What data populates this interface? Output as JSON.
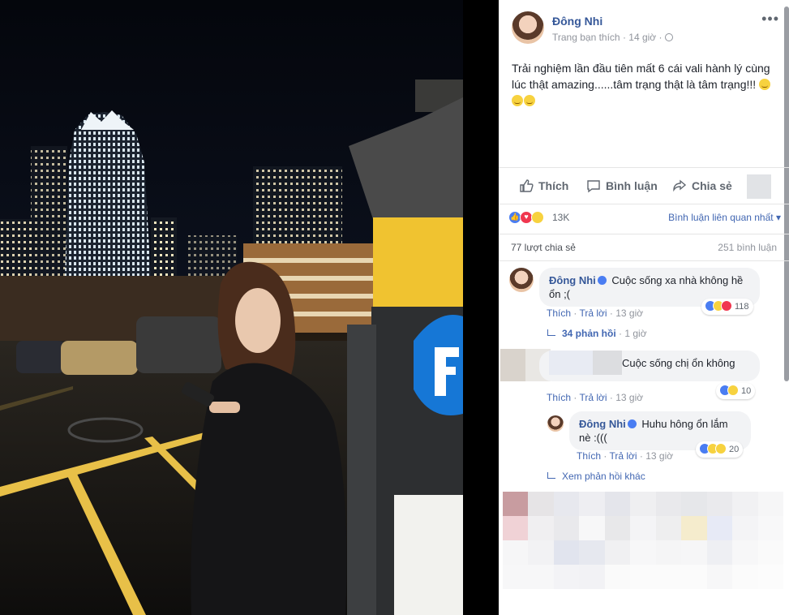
{
  "post": {
    "author": "Đông Nhi",
    "subtitle": "Trang bạn thích · 14 giờ ·",
    "more": "•••",
    "text": "Trải nghiệm lần đầu tiên mất 6 cái vali hành lý cùng lúc thật amazing......tâm trạng thật là tâm trạng!!!",
    "emoji_count": 3
  },
  "actions": {
    "like": "Thích",
    "comment": "Bình luận",
    "share": "Chia sẻ"
  },
  "reactions": {
    "icons": [
      "like-icon",
      "love-icon",
      "wow-icon"
    ],
    "count": "13K",
    "sort_label": "Bình luận liên quan nhất"
  },
  "stats": {
    "shares": "77 lượt chia sẻ",
    "comments": "251 bình luận"
  },
  "comments": [
    {
      "name": "Đông Nhi",
      "text": "Cuộc sống xa nhà không hề ổn ;(",
      "like": "Thích",
      "reply": "Trả lời",
      "time": "13 giờ",
      "reaction_count": "118",
      "replies_link": "34 phản hồi",
      "replies_time": "· 1 giờ"
    },
    {
      "name": "",
      "text": "Cuộc sống chị ổn không",
      "like": "Thích",
      "reply": "Trả lời",
      "time": "13 giờ",
      "reaction_count": "10"
    },
    {
      "name": "Đông Nhi",
      "text": "Huhu hông ổn lắm nè :(((",
      "like": "Thích",
      "reply": "Trả lời",
      "time": "13 giờ",
      "reaction_count": "20"
    }
  ],
  "more_replies": "Xem phản hồi khác",
  "colors": {
    "link": "#365899",
    "like_blue": "#4a7df2",
    "love_red": "#f0374f",
    "reaction_yellow": "#f7d23f",
    "meta_gray": "#90949c"
  }
}
